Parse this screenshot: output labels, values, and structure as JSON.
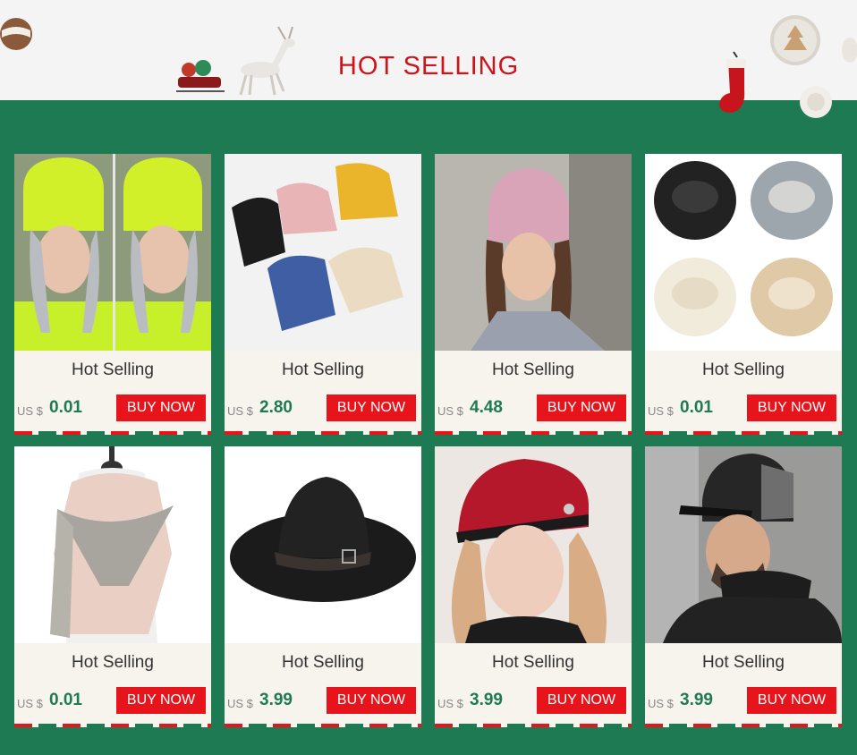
{
  "banner": {
    "title": "HOT  SELLING"
  },
  "colors": {
    "background": "#1e7a52",
    "accent": "#d0121b",
    "button": "#e8141c",
    "price": "#1e7a52"
  },
  "products": [
    {
      "name": "Hot Selling",
      "currency": "US $",
      "price": "0.01",
      "button": "BUY NOW",
      "image": "neon-yellow-beanie-girl-image"
    },
    {
      "name": "Hot Selling",
      "currency": "US $",
      "price": "2.80",
      "button": "BUY NOW",
      "image": "colored-knit-beanies-image"
    },
    {
      "name": "Hot Selling",
      "currency": "US $",
      "price": "4.48",
      "button": "BUY NOW",
      "image": "pink-beanie-woman-image"
    },
    {
      "name": "Hot Selling",
      "currency": "US $",
      "price": "0.01",
      "button": "BUY NOW",
      "image": "neck-warmer-scarves-image"
    },
    {
      "name": "Hot Selling",
      "currency": "US $",
      "price": "0.01",
      "button": "BUY NOW",
      "image": "pink-grey-shawl-image"
    },
    {
      "name": "Hot Selling",
      "currency": "US $",
      "price": "3.99",
      "button": "BUY NOW",
      "image": "black-fedora-hat-image"
    },
    {
      "name": "Hot Selling",
      "currency": "US $",
      "price": "3.99",
      "button": "BUY NOW",
      "image": "red-newsboy-cap-woman-image"
    },
    {
      "name": "Hot Selling",
      "currency": "US $",
      "price": "3.99",
      "button": "BUY NOW",
      "image": "man-beanie-scarf-set-image"
    }
  ]
}
